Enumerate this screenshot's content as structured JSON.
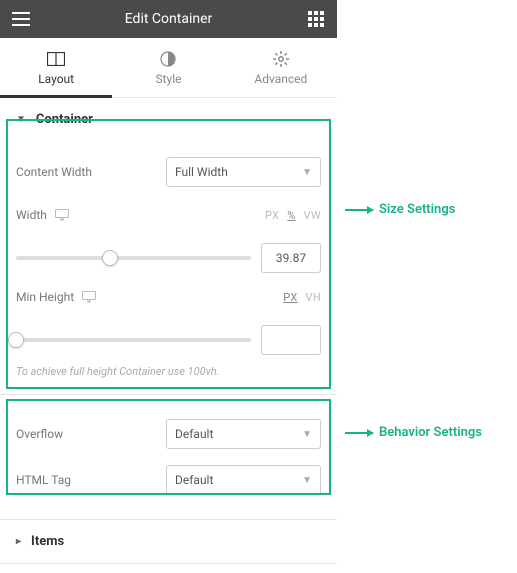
{
  "header": {
    "title": "Edit Container"
  },
  "tabs": [
    {
      "label": "Layout"
    },
    {
      "label": "Style"
    },
    {
      "label": "Advanced"
    }
  ],
  "section_container": {
    "title": "Container",
    "content_width": {
      "label": "Content Width",
      "value": "Full Width"
    },
    "width": {
      "label": "Width",
      "units": [
        "PX",
        "%",
        "VW"
      ],
      "active_unit": "%",
      "value": "39.87",
      "slider_pos": 39.87
    },
    "min_height": {
      "label": "Min Height",
      "units": [
        "PX",
        "VH"
      ],
      "active_unit": "PX",
      "value": "",
      "slider_pos": 0
    },
    "hint": "To achieve full height Container use 100vh."
  },
  "section_behavior": {
    "overflow": {
      "label": "Overflow",
      "value": "Default"
    },
    "html_tag": {
      "label": "HTML Tag",
      "value": "Default"
    }
  },
  "section_items": {
    "title": "Items"
  },
  "annotations": {
    "size": "Size Settings",
    "behavior": "Behavior Settings"
  }
}
